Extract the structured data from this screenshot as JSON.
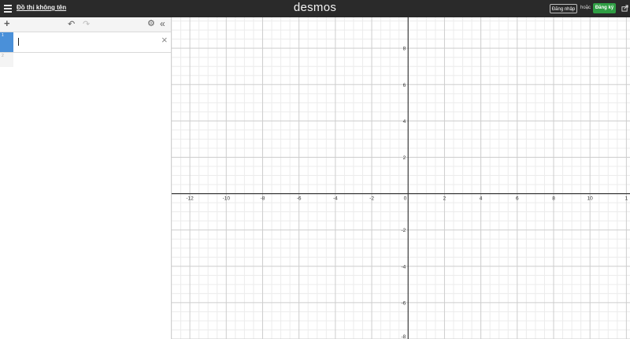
{
  "header": {
    "title": "Đồ thị không tên",
    "brand": "desmos",
    "login_label": "Đăng nhập",
    "or_label": "hoặc",
    "signup_label": "Đăng ký"
  },
  "toolbar": {
    "add_symbol": "+",
    "undo_symbol": "↶",
    "redo_symbol": "↷",
    "settings_symbol": "⚙",
    "collapse_symbol": "«"
  },
  "expressions": [
    {
      "index": "1",
      "value": ""
    },
    {
      "index": "2"
    }
  ],
  "expression_remove_symbol": "×",
  "graph": {
    "x_range": [
      -13,
      12.2
    ],
    "y_range": [
      -8,
      9.7
    ],
    "x_labels": [
      "-12",
      "-10",
      "-8",
      "-6",
      "-4",
      "-2",
      "0",
      "2",
      "4",
      "6",
      "8",
      "10",
      "1"
    ],
    "y_labels": [
      "8",
      "6",
      "4",
      "2",
      "-2",
      "-4",
      "-6",
      "-8"
    ]
  },
  "colors": {
    "topbar": "#2a2a2a",
    "signup": "#2f9e44",
    "expression_index_active": "#4a90d9"
  }
}
